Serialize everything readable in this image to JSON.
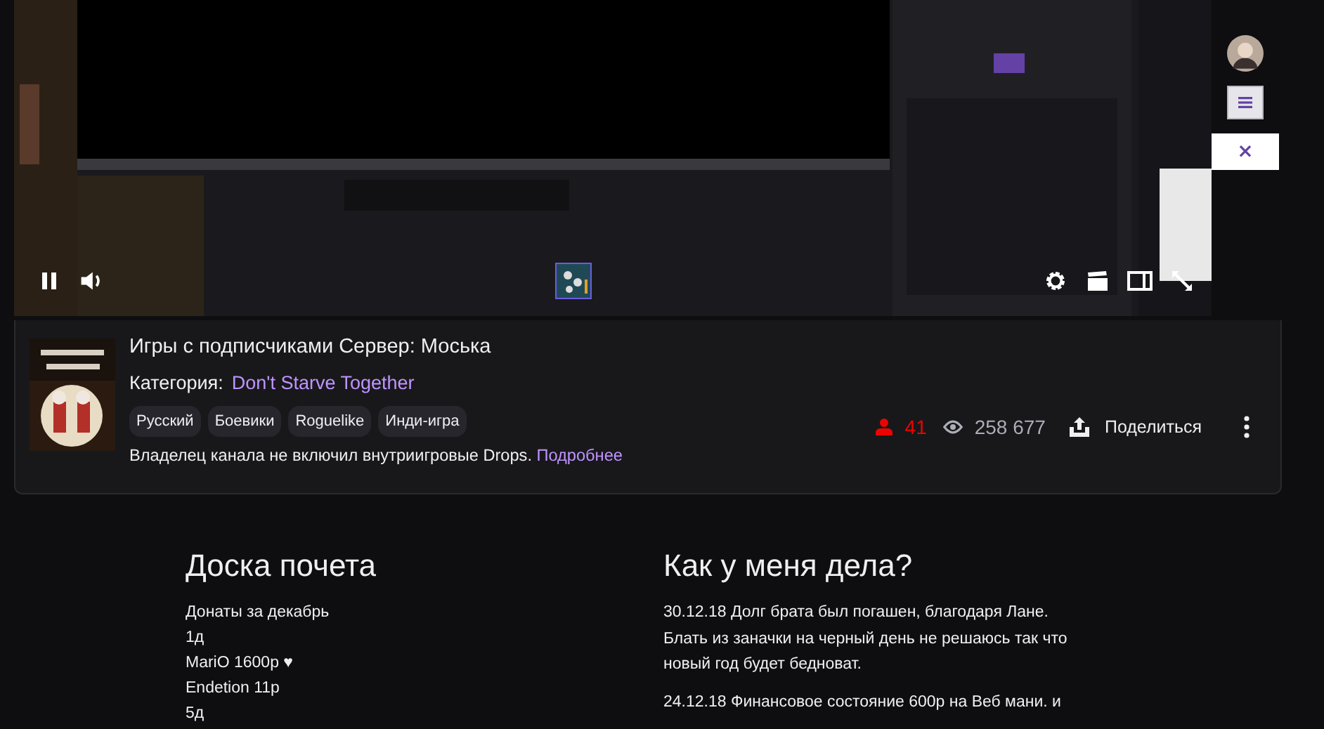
{
  "extension_panel": {
    "close": "×"
  },
  "stream": {
    "title": "Игры с подписчиками Сервер: Моська",
    "category_label": "Категория:",
    "category": "Don't Starve Together",
    "tags": [
      "Русский",
      "Боевики",
      "Roguelike",
      "Инди-игра"
    ],
    "drops_note": "Владелец канала не включил внутриигровые Drops.",
    "drops_link": "Подробнее",
    "viewers": "41",
    "views": "258 677",
    "share": "Поделиться"
  },
  "honor_board": {
    "title": "Доска почета",
    "lines": [
      "Донаты за декабрь",
      "1д",
      "MariO 1600р ♥",
      "Endetion 11р",
      "5д"
    ]
  },
  "status": {
    "title": "Как у меня дела?",
    "paragraphs": [
      "30.12.18 Долг брата был погашен, благодаря Лане. Блать из заначки на черный день не решаюсь так что новый год будет бедноват.",
      "24.12.18 Финансовое состояние 600р на Веб мани. и"
    ]
  }
}
